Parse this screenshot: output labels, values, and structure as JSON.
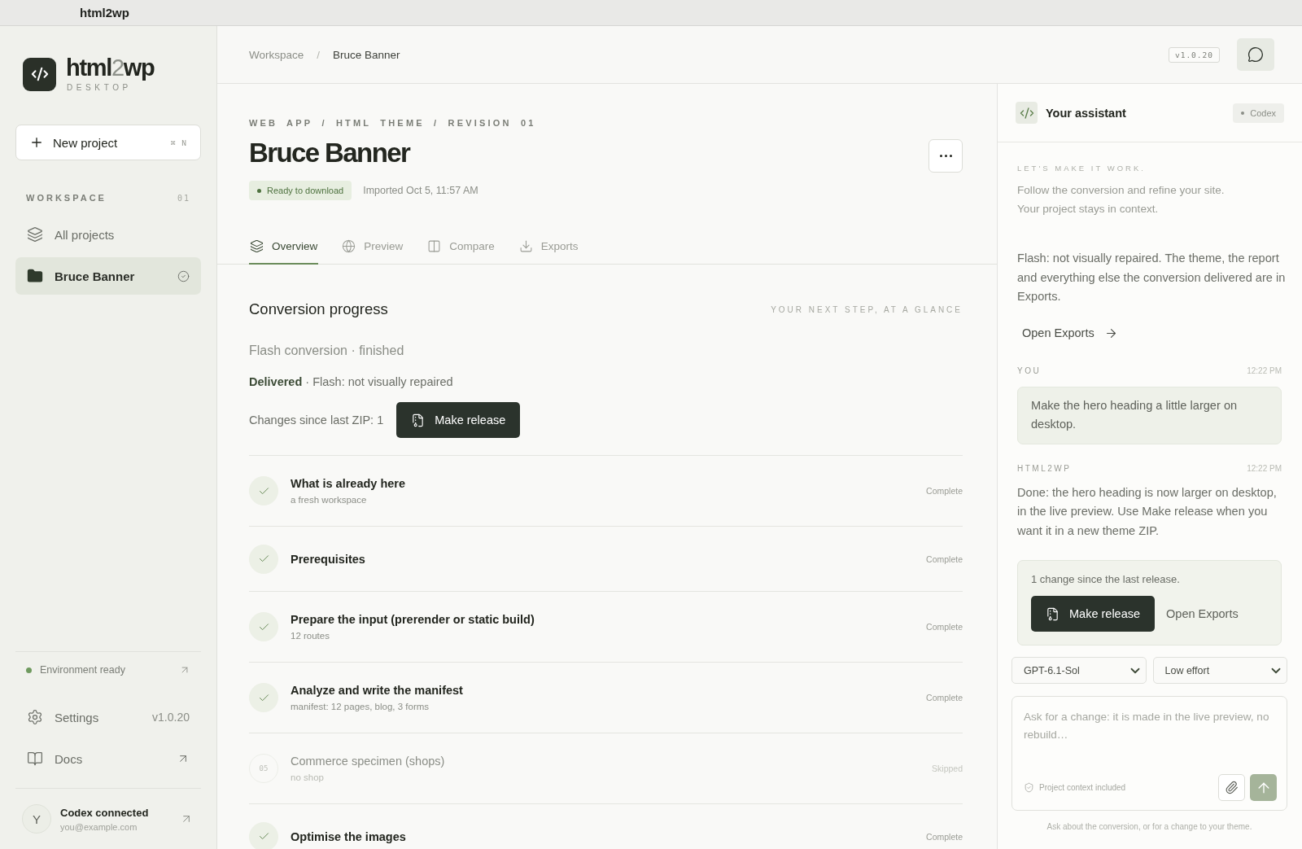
{
  "window": {
    "title": "html2wp"
  },
  "sidebar": {
    "logo": {
      "wordmark": [
        {
          "text": "html",
          "muted": false
        },
        {
          "text": "2",
          "muted": true
        },
        {
          "text": "wp",
          "muted": false
        }
      ],
      "subtitle": "DESKTOP"
    },
    "new_project": {
      "label": "New project",
      "shortcut": "⌘ N"
    },
    "section": {
      "label": "WORKSPACE",
      "count": "01"
    },
    "items": [
      {
        "kind": "all",
        "label": "All projects",
        "selected": false,
        "checked": false
      },
      {
        "kind": "project",
        "label": "Bruce Banner",
        "selected": true,
        "checked": true
      }
    ],
    "environment": {
      "label": "Environment ready",
      "ready": true
    },
    "links": [
      {
        "kind": "settings",
        "label": "Settings",
        "meta": "v1.0.20"
      },
      {
        "kind": "docs",
        "label": "Docs"
      }
    ],
    "account": {
      "initial": "Y",
      "name": "Codex connected",
      "email": "you@example.com"
    }
  },
  "topbar": {
    "breadcrumb": [
      "Workspace",
      "Bruce Banner"
    ],
    "separator": "/",
    "version": "v1.0.20"
  },
  "project": {
    "path": "WEB APP / HTML THEME / REVISION 01",
    "title": "Bruce Banner",
    "status": "Ready to download",
    "imported": "Imported Oct 5, 11:57 AM"
  },
  "tabs": [
    {
      "kind": "overview",
      "label": "Overview",
      "selected": true
    },
    {
      "kind": "preview",
      "label": "Preview",
      "selected": false
    },
    {
      "kind": "compare",
      "label": "Compare",
      "selected": false
    },
    {
      "kind": "exports",
      "label": "Exports",
      "selected": false
    }
  ],
  "progress": {
    "title": "Conversion progress",
    "hint": "YOUR NEXT STEP, AT A GLANCE",
    "run": "Flash conversion · finished",
    "result": "**Delivered** · Flash: not visually repaired",
    "changes": "Changes since last ZIP: 1",
    "release_button": "Make release",
    "steps": [
      {
        "title": "What is already here",
        "detail": "a fresh workspace",
        "status": "Complete",
        "done": true
      },
      {
        "title": "Prerequisites",
        "status": "Complete",
        "done": true
      },
      {
        "title": "Prepare the input (prerender or static build)",
        "detail": "12 routes",
        "status": "Complete",
        "done": true
      },
      {
        "title": "Analyze and write the manifest",
        "detail": "manifest: 12 pages, blog, 3 forms",
        "status": "Complete",
        "done": true
      },
      {
        "number": "05",
        "title": "Commerce specimen (shops)",
        "detail": "no shop",
        "status": "Skipped",
        "done": false
      },
      {
        "title": "Optimise the images",
        "status": "Complete",
        "done": true
      }
    ]
  },
  "assistant": {
    "title": "Your assistant",
    "agent": "Codex",
    "intro_label": "LET'S MAKE IT WORK.",
    "intro": [
      "Follow the conversion and refine your site.",
      "Your project stays in context."
    ],
    "messages": [
      {
        "kind": "notice",
        "text": "Flash: not visually repaired. The theme, the report and everything else the conversion delivered are in Exports.",
        "link": "Open Exports"
      },
      {
        "kind": "user",
        "author": "YOU",
        "time": "12:22 PM",
        "text": "Make the hero heading a little larger on desktop."
      },
      {
        "kind": "reply",
        "author": "HTML2WP",
        "time": "12:22 PM",
        "text": "Done: the hero heading is now larger on desktop, in the live preview. Use Make release when you want it in a new theme ZIP."
      }
    ],
    "release_card": {
      "text": "1 change since the last release.",
      "primary": "Make release",
      "secondary": "Open Exports"
    },
    "model": "GPT-6.1-Sol",
    "effort": "Low effort",
    "composer": {
      "placeholder": "Ask for a change: it is made in the live preview, no rebuild…",
      "context": "Project context included"
    },
    "footnote": "Ask about the conversion, or for a change to your theme."
  }
}
